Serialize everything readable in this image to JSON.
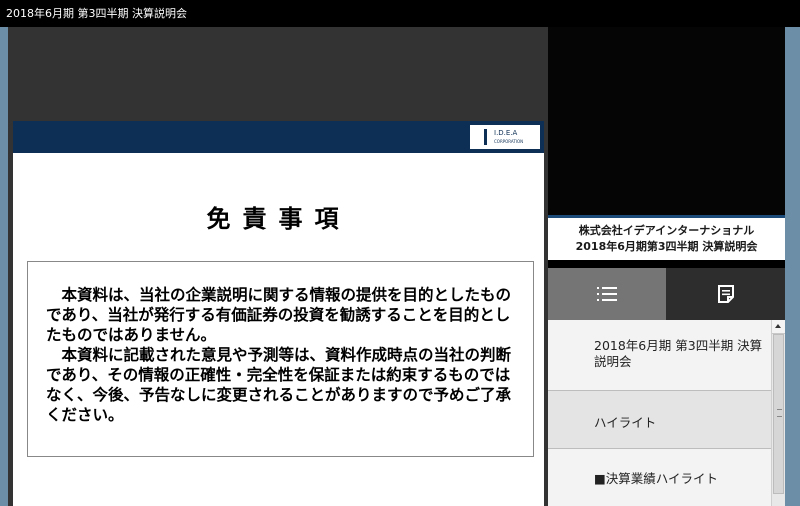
{
  "window": {
    "title": "2018年6月期 第3四半期 決算説明会"
  },
  "slide": {
    "logo_text": "I.D.E.A",
    "logo_sub": "CORPORATION",
    "title": "免責事項",
    "paragraphs": [
      "本資料は、当社の企業説明に関する情報の提供を目的としたものであり、当社が発行する有価証券の投資を勧誘することを目的としたものではありません。",
      "本資料に記載された意見や予測等は、資料作成時点の当社の判断であり、その情報の正確性・完全性を保証または約束するものではなく、今後、予告なしに変更されることがありますので予めご了承ください。"
    ]
  },
  "ticker": {
    "line1": "株式会社イデアインターナショナル",
    "line2": "2018年6月期第3四半期 決算説明会"
  },
  "tabs": {
    "left_icon": "list-icon",
    "right_icon": "document-icon"
  },
  "chapters": [
    {
      "label": "2018年6月期 第3四半期 決算説明会"
    },
    {
      "label": "ハイライト"
    },
    {
      "label": "■決算業績ハイライト"
    }
  ],
  "colors": {
    "header": "#0d2f55",
    "frame": "#6d8ea7",
    "tab_active": "#757575",
    "tab_inactive": "#2d2d2d"
  }
}
